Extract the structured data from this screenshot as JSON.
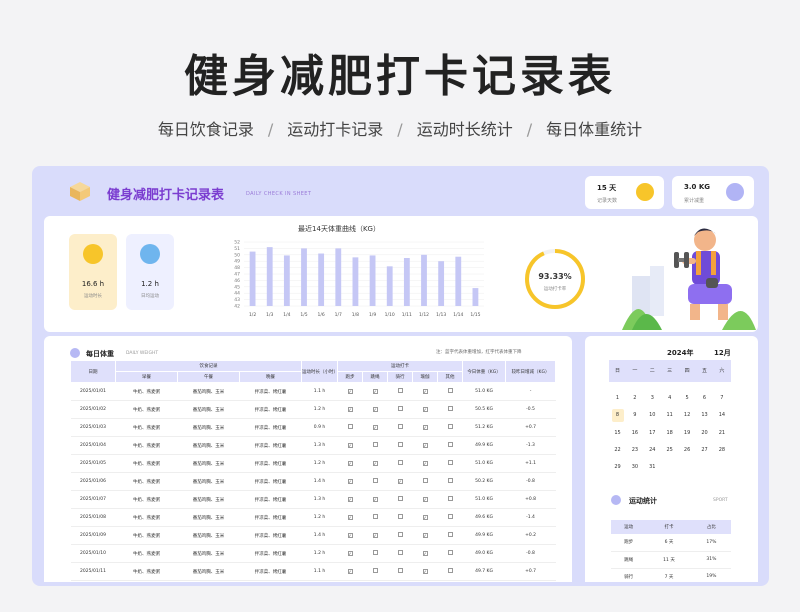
{
  "hero": {
    "title": "健身减肥打卡记录表"
  },
  "subnav": [
    "每日饮食记录",
    "运动打卡记录",
    "运动时长统计",
    "每日体重统计"
  ],
  "sheet": {
    "title": "健身减肥打卡记录表",
    "subtitle": "DAILY CHECK IN SHEET",
    "stats": [
      {
        "value": "15 天",
        "label": "记录天数",
        "color": "#f7c52a"
      },
      {
        "value": "3.0 KG",
        "label": "累计减重",
        "color": "#b1b4f5"
      }
    ]
  },
  "kpis": [
    {
      "value": "16.6 h",
      "label": "运动时长",
      "bg": "#fdeeca",
      "icon_color": "#f7c52a",
      "icon": "runner-icon"
    },
    {
      "value": "1.2 h",
      "label": "日均运动",
      "bg": "#eef0ff",
      "icon_color": "#6fb5ee",
      "icon": "clock-icon"
    }
  ],
  "chart": {
    "title": "最近14天体重曲线（KG）",
    "yticks": [
      "52",
      "51",
      "50",
      "49",
      "48",
      "47",
      "46",
      "45",
      "44",
      "43",
      "42"
    ]
  },
  "chart_data": {
    "type": "bar",
    "title": "最近14天体重曲线（KG）",
    "categories": [
      "1/2",
      "1/3",
      "1/4",
      "1/5",
      "1/6",
      "1/7",
      "1/8",
      "1/9",
      "1/10",
      "1/11",
      "1/12",
      "1/13",
      "1/14",
      "1/15"
    ],
    "values": [
      50.5,
      51.2,
      49.9,
      51.0,
      50.2,
      51.0,
      49.6,
      49.9,
      48.2,
      49.5,
      50.0,
      49.0,
      49.7,
      44.8
    ],
    "ylim": [
      42,
      52
    ],
    "grid": true,
    "color": "#c5c7f5"
  },
  "ring": {
    "value": "93.33%",
    "label": "运动打卡率",
    "fraction": 0.9333,
    "color": "#f7c52a"
  },
  "daily": {
    "title": "每日体重",
    "subtitle": "DAILY WEIGHT",
    "note": "注：蓝字代表体重增加，红字代表体重下降",
    "headers": {
      "date": "日期",
      "diet": "饮食记录",
      "breakfast": "早餐",
      "lunch": "午餐",
      "dinner": "晚餐",
      "duration": "运动时长（小时）",
      "checkin": "运动打卡",
      "run": "跑步",
      "rope": "跳绳",
      "cycle": "骑行",
      "yoga": "瑜伽",
      "other": "其他",
      "weight": "今日体重（KG）",
      "change": "较昨日增减（KG）"
    },
    "rows": [
      {
        "date": "2025/01/01",
        "b": "牛奶、燕麦粥",
        "l": "番茄鸡胸、玉米",
        "d": "拌凉菜、烤红薯",
        "h": "1.1 h",
        "c": [
          1,
          1,
          0,
          1,
          0
        ],
        "w": "51.0 KG",
        "diff": "-",
        "t": ""
      },
      {
        "date": "2025/01/02",
        "b": "牛奶、燕麦粥",
        "l": "番茄鸡胸、玉米",
        "d": "拌凉菜、烤红薯",
        "h": "1.2 h",
        "c": [
          1,
          1,
          0,
          1,
          0
        ],
        "w": "50.5 KG",
        "diff": "-0.5",
        "t": "neg"
      },
      {
        "date": "2025/01/03",
        "b": "牛奶、燕麦粥",
        "l": "番茄鸡胸、玉米",
        "d": "拌凉菜、烤红薯",
        "h": "0.9 h",
        "c": [
          0,
          1,
          0,
          1,
          0
        ],
        "w": "51.2 KG",
        "diff": "+0.7",
        "t": "pos"
      },
      {
        "date": "2025/01/04",
        "b": "牛奶、燕麦粥",
        "l": "番茄鸡胸、玉米",
        "d": "拌凉菜、烤红薯",
        "h": "1.3 h",
        "c": [
          1,
          0,
          0,
          1,
          0
        ],
        "w": "49.9 KG",
        "diff": "-1.3",
        "t": "neg"
      },
      {
        "date": "2025/01/05",
        "b": "牛奶、燕麦粥",
        "l": "番茄鸡胸、玉米",
        "d": "拌凉菜、烤红薯",
        "h": "1.2 h",
        "c": [
          1,
          1,
          0,
          1,
          0
        ],
        "w": "51.0 KG",
        "diff": "+1.1",
        "t": "pos"
      },
      {
        "date": "2025/01/06",
        "b": "牛奶、燕麦粥",
        "l": "番茄鸡胸、玉米",
        "d": "拌凉菜、烤红薯",
        "h": "1.4 h",
        "c": [
          1,
          0,
          1,
          0,
          0
        ],
        "w": "50.2 KG",
        "diff": "-0.8",
        "t": "neg"
      },
      {
        "date": "2025/01/07",
        "b": "牛奶、燕麦粥",
        "l": "番茄鸡胸、玉米",
        "d": "拌凉菜、烤红薯",
        "h": "1.3 h",
        "c": [
          1,
          1,
          0,
          1,
          0
        ],
        "w": "51.0 KG",
        "diff": "+0.8",
        "t": "pos"
      },
      {
        "date": "2025/01/08",
        "b": "牛奶、燕麦粥",
        "l": "番茄鸡胸、玉米",
        "d": "拌凉菜、烤红薯",
        "h": "1.2 h",
        "c": [
          1,
          0,
          0,
          1,
          0
        ],
        "w": "49.6 KG",
        "diff": "-1.4",
        "t": "neg"
      },
      {
        "date": "2025/01/09",
        "b": "牛奶、燕麦粥",
        "l": "番茄鸡胸、玉米",
        "d": "拌凉菜、烤红薯",
        "h": "1.4 h",
        "c": [
          1,
          1,
          0,
          1,
          0
        ],
        "w": "49.9 KG",
        "diff": "+0.2",
        "t": "pos"
      },
      {
        "date": "2025/01/10",
        "b": "牛奶、燕麦粥",
        "l": "番茄鸡胸、玉米",
        "d": "拌凉菜、烤红薯",
        "h": "1.2 h",
        "c": [
          1,
          0,
          0,
          1,
          0
        ],
        "w": "49.0 KG",
        "diff": "-0.8",
        "t": "neg"
      },
      {
        "date": "2025/01/11",
        "b": "牛奶、燕麦粥",
        "l": "番茄鸡胸、玉米",
        "d": "拌凉菜、烤红薯",
        "h": "1.1 h",
        "c": [
          1,
          0,
          0,
          1,
          0
        ],
        "w": "49.7 KG",
        "diff": "+0.7",
        "t": "pos"
      }
    ]
  },
  "calendar": {
    "year": "2024年",
    "month": "12月",
    "weekdays": [
      "日",
      "一",
      "二",
      "三",
      "四",
      "五",
      "六"
    ],
    "days": [
      "1",
      "2",
      "3",
      "4",
      "5",
      "6",
      "7",
      "8",
      "9",
      "10",
      "11",
      "12",
      "13",
      "14",
      "15",
      "16",
      "17",
      "18",
      "19",
      "20",
      "21",
      "22",
      "23",
      "24",
      "25",
      "26",
      "27",
      "28",
      "29",
      "30",
      "31"
    ],
    "today": "8"
  },
  "sport": {
    "title": "运动统计",
    "subtitle": "SPORT",
    "headers": [
      "运动",
      "打卡",
      "占比"
    ],
    "rows": [
      [
        "跑步",
        "6 天",
        "17%"
      ],
      [
        "跳绳",
        "11 天",
        "31%"
      ],
      [
        "骑行",
        "7 天",
        "19%"
      ]
    ]
  }
}
